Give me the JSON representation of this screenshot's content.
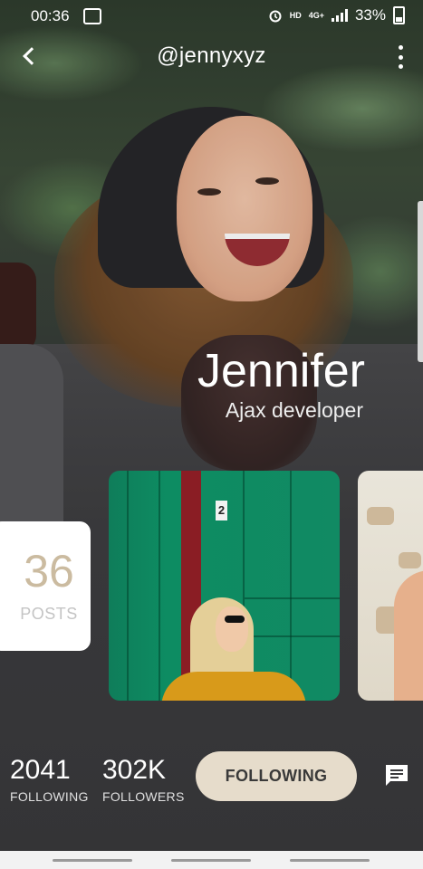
{
  "status_bar": {
    "time": "00:36",
    "network_hd": "HD",
    "network_type": "4G+",
    "battery_percent": "33%"
  },
  "header": {
    "back_icon": "chevron-left-icon",
    "handle": "@jennyxyz",
    "menu_icon": "more-vertical-icon"
  },
  "profile": {
    "name": "Jennifer",
    "role": "Ajax developer"
  },
  "posts": {
    "count": "36",
    "label": "POSTS"
  },
  "gallery": {
    "items": [
      "photo-woman-green-door",
      "photo-woman-white-wall"
    ],
    "door_number": "2"
  },
  "stats": {
    "following_count": "2041",
    "following_label": "FOLLOWING",
    "followers_count": "302K",
    "followers_label": "FOLLOWERS"
  },
  "actions": {
    "follow_button_label": "FOLLOWING",
    "chat_icon": "message-icon"
  },
  "colors": {
    "accent": "#e6dccb",
    "posts_number": "#cbbba0"
  }
}
